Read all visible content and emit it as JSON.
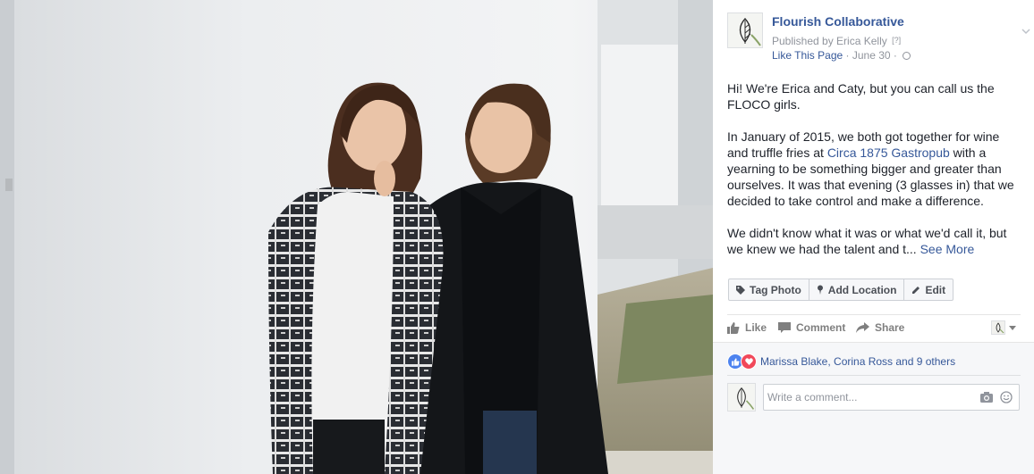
{
  "post": {
    "page_name": "Flourish Collaborative",
    "published_by": "Published by Erica Kelly",
    "published_by_hint": "[?]",
    "like_page": "Like This Page",
    "meta_sep": "·",
    "date": "June 30",
    "dot_sep": "·",
    "icons": {
      "menu": "chevron-down-icon",
      "audience": "globe-icon"
    }
  },
  "body": {
    "p1": "Hi! We're Erica and Caty, but you can call us the FLOCO girls.",
    "p2_before": "In January of 2015, we both got together for wine and truffle fries at ",
    "p2_link": "Circa 1875 Gastropub",
    "p2_after": " with a yearning to be something bigger and greater than ourselves. It was that evening (3 glasses in) that we decided to take control and make a difference.",
    "p3": "We didn't know what it was or what we'd call it, but we knew we had the talent and t...",
    "see_more": "See More"
  },
  "photo_actions": [
    {
      "label": "Tag Photo",
      "icon": "tag-icon"
    },
    {
      "label": "Add Location",
      "icon": "location-pin-icon"
    },
    {
      "label": "Edit",
      "icon": "pencil-icon"
    }
  ],
  "ufi": {
    "like": "Like",
    "comment": "Comment",
    "share": "Share"
  },
  "reactions": {
    "types": [
      "like",
      "love"
    ],
    "text": "Marissa Blake, Corina Ross and 9 others",
    "colors": {
      "like": "#4d83ef",
      "love": "#f1485a"
    }
  },
  "comment_box": {
    "placeholder": "Write a comment...",
    "icons": [
      "camera-icon",
      "smiley-icon"
    ]
  },
  "colors": {
    "link": "#365899",
    "muted": "#90949c",
    "text": "#1d2129"
  }
}
